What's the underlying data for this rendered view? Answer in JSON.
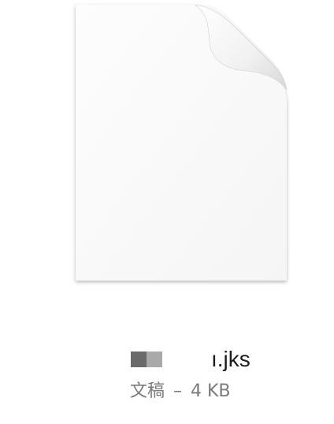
{
  "file": {
    "icon": "blank-document-icon",
    "name_suffix": "ı.jks",
    "kind": "文稿",
    "separator": "–",
    "size": "4 KB",
    "name_redaction_colors": [
      "#6a6a6a",
      "#a9a9a9"
    ]
  }
}
